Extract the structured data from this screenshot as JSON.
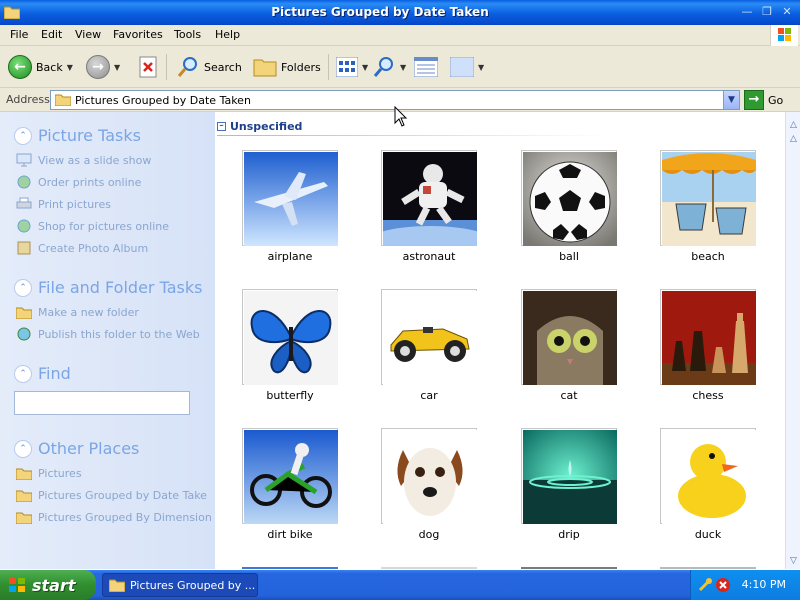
{
  "window": {
    "title": "Pictures Grouped by Date Taken",
    "controls": [
      "minimize",
      "maximize",
      "close"
    ]
  },
  "menu": {
    "items": [
      "File",
      "Edit",
      "View",
      "Favorites",
      "Tools",
      "Help"
    ]
  },
  "toolbar": {
    "back_label": "Back",
    "search_label": "Search",
    "folders_label": "Folders"
  },
  "address": {
    "label": "Address",
    "value": "Pictures Grouped by Date Taken",
    "go_label": "Go"
  },
  "taskpane": {
    "picture_tasks": {
      "title": "Picture Tasks",
      "items": [
        "View as a slide show",
        "Order prints online",
        "Print pictures",
        "Shop for pictures online",
        "Create Photo Album"
      ]
    },
    "file_folder_tasks": {
      "title": "File and Folder Tasks",
      "items": [
        "Make a new folder",
        "Publish this folder to the Web"
      ]
    },
    "find": {
      "title": "Find",
      "input_value": ""
    },
    "other_places": {
      "title": "Other Places",
      "items": [
        "Pictures",
        "Pictures Grouped by Date Take",
        "Pictures Grouped By Dimension"
      ]
    }
  },
  "content": {
    "group_title": "Unspecified",
    "thumbnails": [
      "airplane",
      "astronaut",
      "ball",
      "beach",
      "butterfly",
      "car",
      "cat",
      "chess",
      "dirt bike",
      "dog",
      "drip",
      "duck"
    ]
  },
  "taskbar": {
    "start_label": "start",
    "window_label": "Pictures Grouped by ...",
    "clock": "4:10 PM"
  },
  "colors": {
    "title_blue": "#0a5fe0",
    "taskpane_heading": "#7ba5e5",
    "start_green": "#2f8f2f"
  }
}
